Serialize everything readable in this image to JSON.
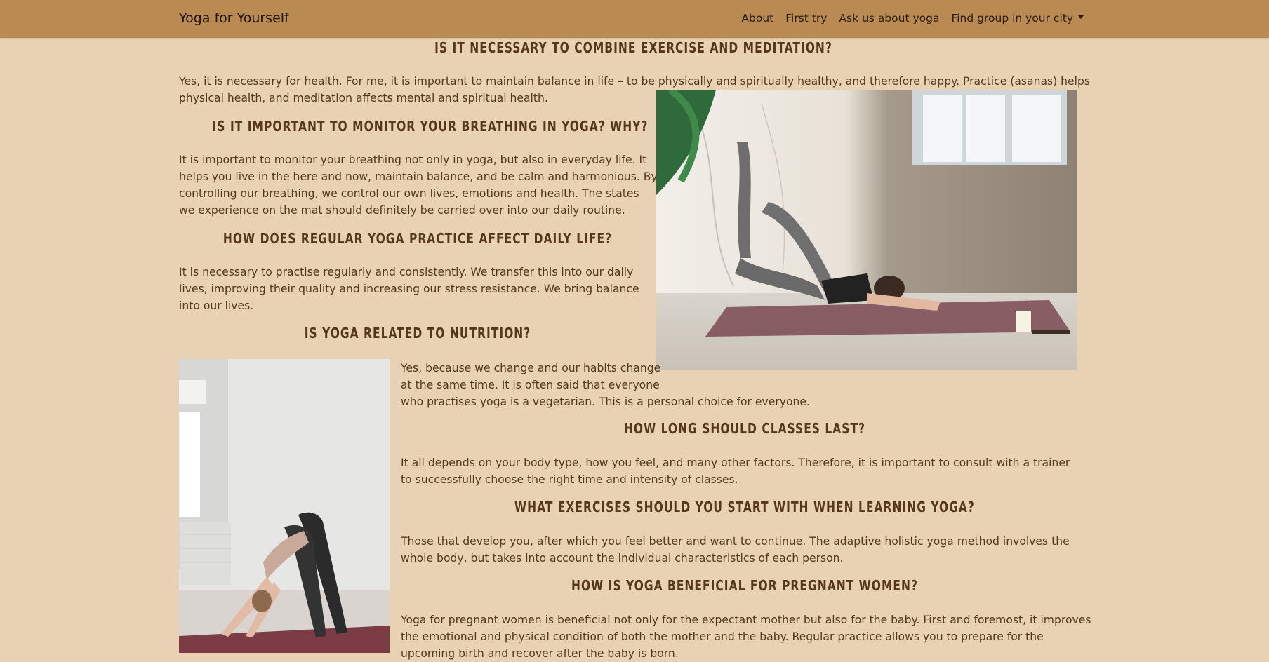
{
  "nav": {
    "brand": "Yoga for Yourself",
    "links": [
      "About",
      "First try",
      "Ask us about yoga",
      "Find group in your city"
    ]
  },
  "sections": [
    {
      "title": "IS IT NECESSARY TO COMBINE EXERCISE AND MEDITATION?",
      "text": "Yes, it is necessary for health. For me, it is important to maintain balance in life – to be physically and spiritually healthy, and therefore happy. Practice (asanas) helps physical health, and meditation affects mental and spiritual health."
    },
    {
      "title": "IS IT IMPORTANT TO MONITOR YOUR BREATHING IN YOGA? WHY?",
      "text": "It is important to monitor your breathing not only in yoga, but also in everyday life. It helps you live in the here and now, maintain balance, and be calm and harmonious. By controlling our breathing, we control our own lives, emotions and health. The states we experience on the mat should definitely be carried over into our daily routine."
    },
    {
      "title": "HOW DOES REGULAR YOGA PRACTICE AFFECT DAILY LIFE?",
      "text": "It is necessary to practise regularly and consistently. We transfer this into our daily lives, improving their quality and increasing our stress resistance. We bring balance into our lives."
    },
    {
      "title": "IS YOGA RELATED TO NUTRITION?",
      "text_lines": [
        "Yes, because we change and our habits change",
        "at the same time. It is often said that everyone",
        "who practises yoga is a vegetarian. This is a personal choice for everyone."
      ]
    },
    {
      "title": "HOW LONG SHOULD CLASSES LAST?",
      "text": "It all depends on your body type, how you feel, and many other factors. Therefore, it is important to consult with a trainer to successfully choose the right time and intensity of classes."
    },
    {
      "title": "WHAT EXERCISES SHOULD YOU START WITH WHEN LEARNING YOGA?",
      "text": "Those that develop you, after which you feel better and want to continue. The adaptive holistic yoga method involves the whole body, but takes into account the individual characteristics of each person."
    },
    {
      "title": "HOW IS YOGA BENEFICIAL FOR PREGNANT WOMEN?",
      "text": "Yoga for pregnant women is beneficial not only for the expectant mother but also for the baby. First and foremost, it improves the emotional and physical condition of both the mother and the baby. Regular practice allows you to prepare for the upcoming birth and recover after the baby is born."
    }
  ]
}
